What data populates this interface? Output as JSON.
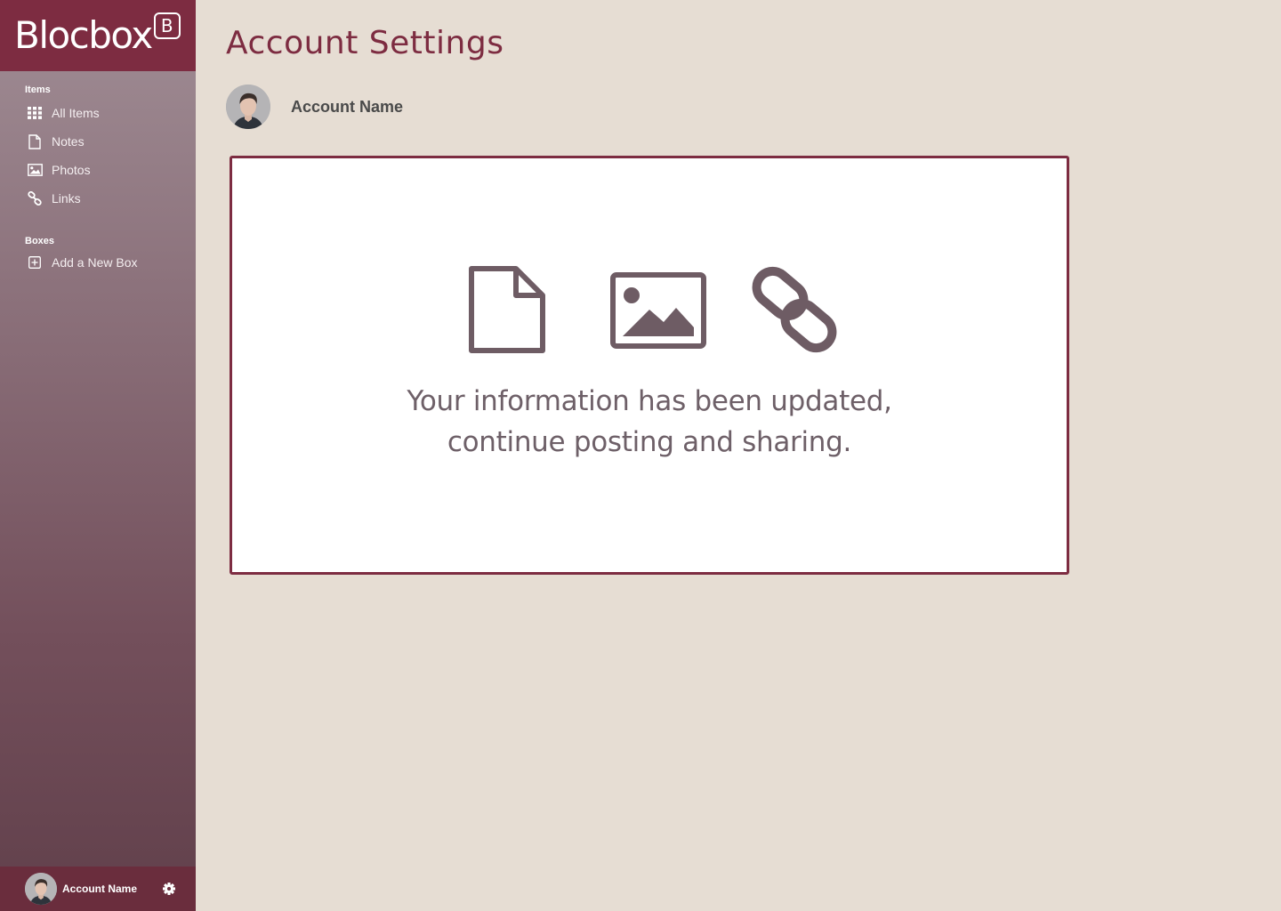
{
  "brand": {
    "name": "Blocbox",
    "mark": "B"
  },
  "sidebar": {
    "items_label": "Items",
    "items": [
      {
        "label": "All Items",
        "icon": "grid-icon"
      },
      {
        "label": "Notes",
        "icon": "note-icon"
      },
      {
        "label": "Photos",
        "icon": "photo-icon"
      },
      {
        "label": "Links",
        "icon": "link-icon"
      }
    ],
    "boxes_label": "Boxes",
    "boxes": [
      {
        "label": "Add a New Box",
        "icon": "plus-box-icon"
      }
    ]
  },
  "userbar": {
    "name": "Account Name",
    "icon": "gear-icon"
  },
  "main": {
    "title": "Account Settings",
    "account_name": "Account Name",
    "card": {
      "icons": [
        "document-icon",
        "image-icon",
        "chain-link-icon"
      ],
      "message_line1": "Your information has been updated,",
      "message_line2": "continue posting and sharing."
    }
  },
  "colors": {
    "brand": "#7d2c41",
    "background": "#e6ddd3",
    "icon_gray": "#6e5c64"
  }
}
